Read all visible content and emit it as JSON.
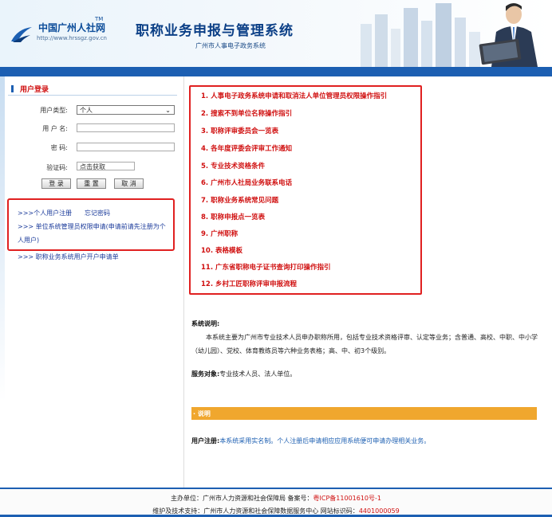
{
  "header": {
    "logo_name": "中国广州人社网",
    "logo_tm": "TM",
    "logo_url": "http://www.hrssgz.gov.cn",
    "title": "职称业务申报与管理系统",
    "subtitle": "广州市人事电子政务系统"
  },
  "login": {
    "heading": "用户登录",
    "user_type_label": "用户类型:",
    "user_type_value": "个人",
    "username_label": "用 户 名:",
    "password_label": "密  码:",
    "captcha_label": "验证码:",
    "captcha_value": "点击获取",
    "login_btn": "登 录",
    "reset_btn": "重 置",
    "cancel_btn": "取 消"
  },
  "links": {
    "personal_register": ">>>个人用户注册",
    "forgot_password": "忘记密码",
    "unit_admin_line1": ">>> 单位系统管理员权限申请(申请前请先注册为个",
    "unit_admin_line2": "人用户)",
    "account_form": ">>> 职称业务系统用户开户申请单"
  },
  "guide_items": [
    "1. 人事电子政务系统申请和取消法人单位管理员权限操作指引",
    "2. 搜索不到单位名称操作指引",
    "3. 职称评审委员会一览表",
    "4. 各年度评委会评审工作通知",
    "5. 专业技术资格条件",
    "6. 广州市人社局业务联系电话",
    "7. 职称业务系统常见问题",
    "8. 职称申报点一览表",
    "9. 广州职称",
    "10. 表格模板",
    "11. 广东省职称电子证书查询打印操作指引",
    "12. 乡村工匠职称评审申报流程"
  ],
  "description": {
    "title": "系统说明:",
    "body": "本系统主要为广州市专业技术人员申办职称所用，包括专业技术资格评审、认定等业务；含普通、高校、中职、中小学（幼儿园）、党校、体育教练员等六种业务表格；高、中、初3个级别。",
    "service_label": "服务对象:",
    "service_value": "专业技术人员、法人单位。",
    "note_bar": "· 说明",
    "reg_label": "用户注册:",
    "reg_value": "本系统采用实名制。个人注册后申请相应应用系统便可申请办理相关业务。"
  },
  "footer": {
    "line1_prefix": "主办单位：广州市人力资源和社会保障局 备案号：",
    "icp": "粤ICP备11001610号-1",
    "line2_prefix": "维护及技术支持：广州市人力资源和社会保障数据服务中心 网站标识码：",
    "site_code": "4401000059"
  },
  "colors": {
    "brand_blue": "#1c5fb2",
    "accent_red": "#d01010",
    "note_orange": "#f0a72e"
  }
}
